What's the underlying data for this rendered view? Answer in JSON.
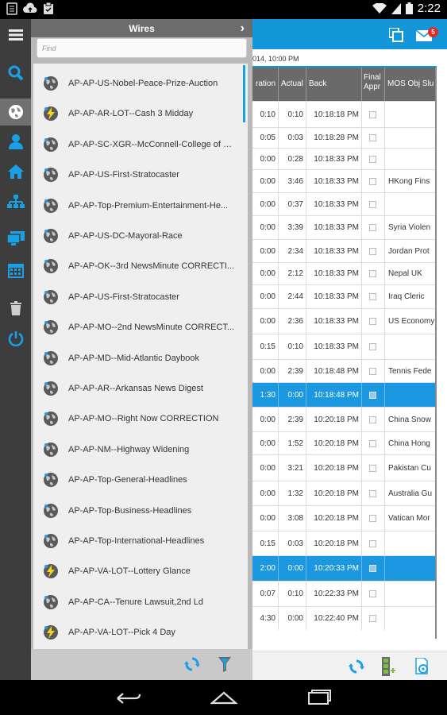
{
  "status_bar": {
    "time": "2:22"
  },
  "sidebar": {
    "items": [
      {
        "name": "menu-icon"
      },
      {
        "name": "search-icon"
      },
      {
        "name": "wires-globe-icon",
        "active": true
      },
      {
        "name": "user-icon"
      },
      {
        "name": "home-icon"
      },
      {
        "name": "org-chart-icon"
      },
      {
        "name": "monitor-icon"
      },
      {
        "name": "calendar-icon"
      },
      {
        "name": "trash-icon"
      },
      {
        "name": "power-icon"
      }
    ]
  },
  "wires_panel": {
    "title": "Wires",
    "find_placeholder": "Find",
    "items": [
      {
        "label": "AP-AP-US-Nobel-Peace-Prize-Auction",
        "icon": "globe"
      },
      {
        "label": "AP-AP-AR-LOT--Cash 3 Midday",
        "icon": "lightning"
      },
      {
        "label": "AP-AP-SC-XGR--McConnell-College of C...",
        "icon": "globe"
      },
      {
        "label": "AP-AP-US-First-Stratocaster",
        "icon": "globe"
      },
      {
        "label": "AP-AP-Top-Premium-Entertainment-He...",
        "icon": "globe"
      },
      {
        "label": "AP-AP-US-DC-Mayoral-Race",
        "icon": "globe"
      },
      {
        "label": "AP-AP-OK--3rd NewsMinute CORRECTI...",
        "icon": "globe"
      },
      {
        "label": "AP-AP-US-First-Stratocaster",
        "icon": "globe"
      },
      {
        "label": "AP-AP-MO--2nd NewsMinute CORRECT...",
        "icon": "globe"
      },
      {
        "label": "AP-AP-MD--Mid-Atlantic Daybook",
        "icon": "globe"
      },
      {
        "label": "AP-AP-AR--Arkansas News Digest",
        "icon": "globe"
      },
      {
        "label": "AP-AP-MO--Right Now CORRECTION",
        "icon": "globe"
      },
      {
        "label": "AP-AP-NM--Highway Widening",
        "icon": "globe"
      },
      {
        "label": "AP-AP-Top-General-Headlines",
        "icon": "globe"
      },
      {
        "label": "AP-AP-Top-Business-Headlines",
        "icon": "globe"
      },
      {
        "label": "AP-AP-Top-International-Headlines",
        "icon": "globe"
      },
      {
        "label": "AP-AP-VA-LOT--Lottery Glance",
        "icon": "lightning"
      },
      {
        "label": "AP-AP-CA--Tenure Lawsuit,2nd Ld",
        "icon": "globe"
      },
      {
        "label": "AP-AP-VA-LOT--Pick 4 Day",
        "icon": "lightning"
      }
    ]
  },
  "main": {
    "mail_badge": "5",
    "date_text": "014, 10:00 PM",
    "columns": [
      {
        "label": "ration"
      },
      {
        "label": "Actual"
      },
      {
        "label": "Back"
      },
      {
        "label": "Final\nAppr"
      },
      {
        "label": "MOS Obj Slu"
      }
    ],
    "rows": [
      {
        "duration": "0:10",
        "actual": "0:10",
        "back": "10:18:18 PM",
        "slug": ""
      },
      {
        "duration": "0:05",
        "actual": "0:03",
        "back": "10:18:28 PM",
        "slug": ""
      },
      {
        "duration": "0:00",
        "actual": "0:28",
        "back": "10:18:33 PM",
        "slug": ""
      },
      {
        "duration": "0:00",
        "actual": "3:46",
        "back": "10:18:33 PM",
        "slug": "HKong Fins"
      },
      {
        "duration": "0:00",
        "actual": "0:37",
        "back": "10:18:33 PM",
        "slug": ""
      },
      {
        "duration": "0:00",
        "actual": "3:39",
        "back": "10:18:33 PM",
        "slug": "Syria Violen"
      },
      {
        "duration": "0:00",
        "actual": "2:34",
        "back": "10:18:33 PM",
        "slug": "Jordan Prot"
      },
      {
        "duration": "0:00",
        "actual": "2:12",
        "back": "10:18:33 PM",
        "slug": "Nepal UK"
      },
      {
        "duration": "0:00",
        "actual": "2:44",
        "back": "10:18:33 PM",
        "slug": "Iraq Cleric"
      },
      {
        "duration": "0:00",
        "actual": "2:36",
        "back": "10:18:33 PM",
        "slug": "US Economy"
      },
      {
        "duration": "0:15",
        "actual": "0:10",
        "back": "10:18:33 PM",
        "slug": ""
      },
      {
        "duration": "0:00",
        "actual": "2:39",
        "back": "10:18:48 PM",
        "slug": "Tennis Fede"
      },
      {
        "duration": "1:30",
        "actual": "0:00",
        "back": "10:18:48 PM",
        "slug": "",
        "selected": true
      },
      {
        "duration": "0:00",
        "actual": "2:39",
        "back": "10:20:18 PM",
        "slug": "China Snow"
      },
      {
        "duration": "0:00",
        "actual": "1:52",
        "back": "10:20:18 PM",
        "slug": "China Hong"
      },
      {
        "duration": "0:00",
        "actual": "3:21",
        "back": "10:20:18 PM",
        "slug": "Pakistan Cu"
      },
      {
        "duration": "0:00",
        "actual": "1:32",
        "back": "10:20:18 PM",
        "slug": "Australia Gu"
      },
      {
        "duration": "0:00",
        "actual": "3:08",
        "back": "10:20:18 PM",
        "slug": "Vatican Mor"
      },
      {
        "duration": "0:15",
        "actual": "0:03",
        "back": "10:20:18 PM",
        "slug": ""
      },
      {
        "duration": "2:00",
        "actual": "0:00",
        "back": "10:20:33 PM",
        "slug": "",
        "selected": true
      },
      {
        "duration": "0:07",
        "actual": "0:10",
        "back": "10:22:33 PM",
        "slug": ""
      },
      {
        "duration": "4:30",
        "actual": "0:00",
        "back": "10:22:40 PM",
        "slug": ""
      }
    ]
  }
}
